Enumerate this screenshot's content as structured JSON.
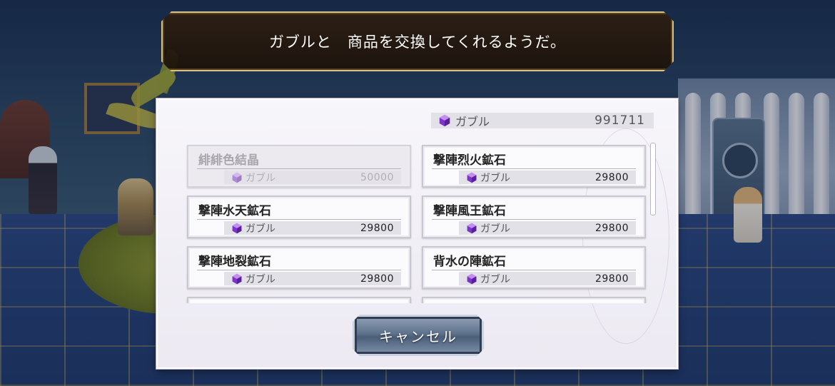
{
  "message": "ガブルと　商品を交換してくれるようだ。",
  "balance": {
    "currency": "ガブル",
    "amount": "991711",
    "icon": "purple-gem-icon"
  },
  "items": [
    {
      "name": "緋緋色結晶",
      "currency": "ガブル",
      "price": "50000",
      "disabled": true
    },
    {
      "name": "撃陣烈火鉱石",
      "currency": "ガブル",
      "price": "29800",
      "disabled": false
    },
    {
      "name": "撃陣水天鉱石",
      "currency": "ガブル",
      "price": "29800",
      "disabled": false
    },
    {
      "name": "撃陣風王鉱石",
      "currency": "ガブル",
      "price": "29800",
      "disabled": false
    },
    {
      "name": "撃陣地裂鉱石",
      "currency": "ガブル",
      "price": "29800",
      "disabled": false
    },
    {
      "name": "背水の陣鉱石",
      "currency": "ガブル",
      "price": "29800",
      "disabled": false
    }
  ],
  "cancel_label": "キャンセル",
  "colors": {
    "gem": "#8a3fd6",
    "panel": "#f4f3f7",
    "message_border": "#d7c38a"
  }
}
